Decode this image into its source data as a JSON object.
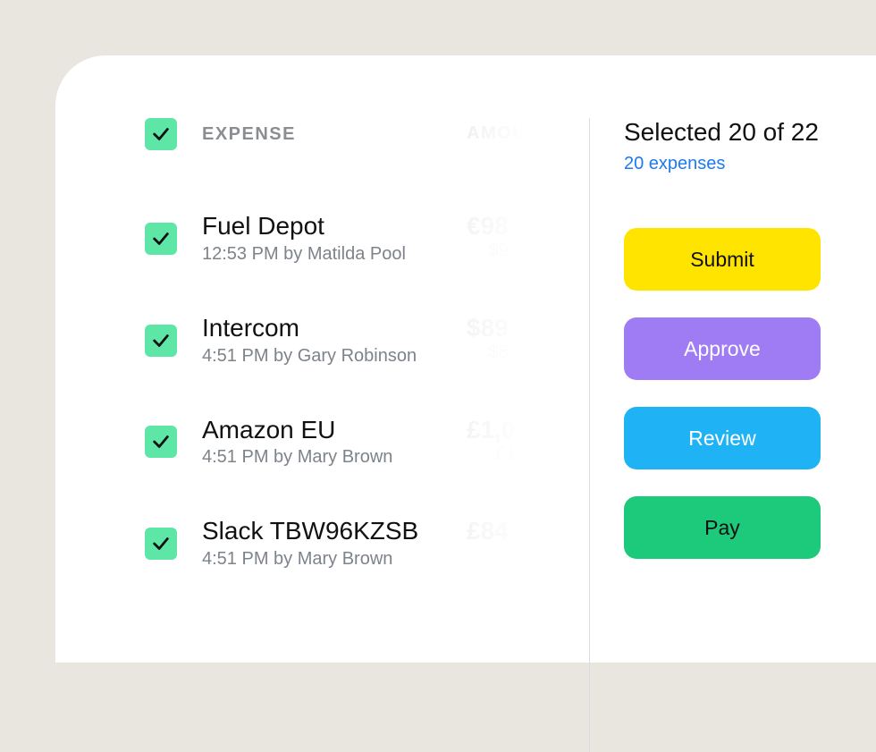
{
  "columns": {
    "expense_label": "EXPENSE",
    "amount_label": "AMOUNT"
  },
  "rows": [
    {
      "title": "Fuel Depot",
      "meta": "12:53 PM by Matilda Pool",
      "amount_main": "€98",
      "amount_sub": "$9"
    },
    {
      "title": "Intercom",
      "meta": "4:51 PM by Gary Robinson",
      "amount_main": "$89",
      "amount_sub": "$8"
    },
    {
      "title": "Amazon EU",
      "meta": "4:51 PM by Mary Brown",
      "amount_main": "£1,0",
      "amount_sub": "£1"
    },
    {
      "title": "Slack TBW96KZSB",
      "meta": "4:51 PM by Mary Brown",
      "amount_main": "£84",
      "amount_sub": ""
    }
  ],
  "selection": {
    "title": "Selected 20 of 22",
    "subtitle": "20 expenses"
  },
  "actions": {
    "submit": "Submit",
    "approve": "Approve",
    "review": "Review",
    "pay": "Pay"
  }
}
